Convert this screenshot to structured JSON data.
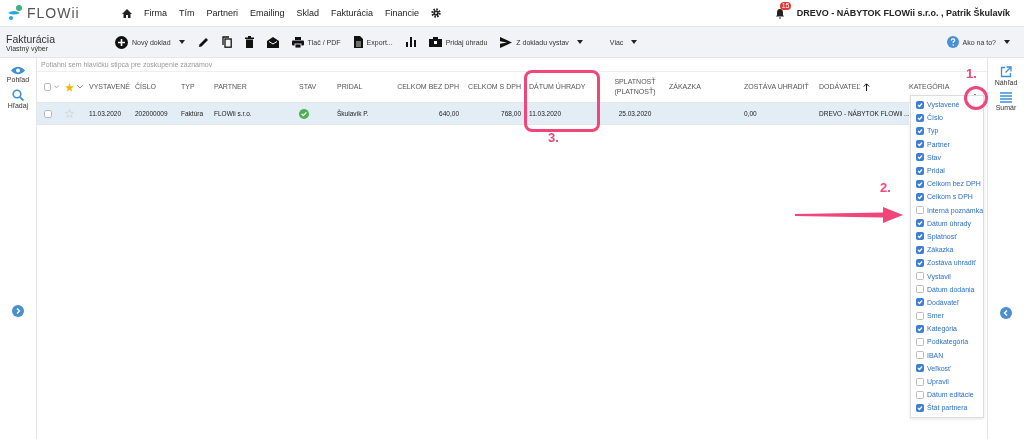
{
  "nav": {
    "logo": "FLOWii",
    "items": [
      "Firma",
      "Tím",
      "Partneri",
      "Emailing",
      "Sklad",
      "Fakturácia",
      "Financie"
    ],
    "notification_count": "15",
    "account": "DREVO - NÁBYTOK FLOWii s.r.o. , Patrik Škulavík"
  },
  "page": {
    "title": "Fakturácia",
    "subtitle": "Vlastný výber"
  },
  "toolbar": [
    {
      "kind": "new",
      "label": "Nový doklad",
      "dropdown": true
    },
    {
      "kind": "edit",
      "dropdown": false
    },
    {
      "kind": "copy",
      "dropdown": false
    },
    {
      "kind": "delete",
      "dropdown": false
    },
    {
      "kind": "mail",
      "dropdown": false
    },
    {
      "kind": "print",
      "label": "Tlač / PDF",
      "dropdown": false
    },
    {
      "kind": "export",
      "label": "Export...",
      "dropdown": false
    },
    {
      "kind": "chart",
      "dropdown": false
    },
    {
      "kind": "payment",
      "label": "Pridaj úhradu",
      "dropdown": false
    },
    {
      "kind": "send",
      "label": "Z dokladu vystav",
      "dropdown": true
    },
    {
      "kind": "more",
      "label": "Viac",
      "dropdown": true
    }
  ],
  "help": {
    "label": "Ako na to?"
  },
  "left_sidebar": [
    {
      "kind": "view",
      "label": "Pohľad"
    },
    {
      "kind": "search",
      "label": "Hľadaj"
    }
  ],
  "right_sidebar": [
    {
      "kind": "preview",
      "label": "Náhľad"
    },
    {
      "kind": "summary",
      "label": "Sumár"
    }
  ],
  "group_hint": "Potiahni sem hlavičku stĺpca pre zoskupenie záznamov",
  "select_all_checked": false,
  "columns": [
    {
      "label": "VYSTAVENÉ",
      "sorted": false
    },
    {
      "label": "ČÍSLO",
      "sorted": false
    },
    {
      "label": "TYP",
      "sorted": false
    },
    {
      "label": "PARTNER",
      "sorted": false
    },
    {
      "label": "STAV",
      "sorted": false
    },
    {
      "label": "PRIDAL",
      "sorted": false
    },
    {
      "label": "CELKOM BEZ DPH",
      "sorted": false
    },
    {
      "label": "CELKOM S DPH",
      "sorted": false
    },
    {
      "label": "DÁTUM ÚHRADY",
      "sorted": false
    },
    {
      "label": "SPLATNOSŤ (PLATNOSŤ)",
      "sorted": false
    },
    {
      "label": "ZÁKAZKA",
      "sorted": false
    },
    {
      "label": "ZOSTÁVA UHRADIŤ",
      "sorted": false
    },
    {
      "label": "DODÁVATEĽ",
      "sorted": true
    },
    {
      "label": "KATEGÓRIA",
      "sorted": false
    }
  ],
  "rows": [
    {
      "selected": true,
      "checked": false,
      "starred": false,
      "cells": [
        {
          "text": "11.03.2020"
        },
        {
          "text": "202000009"
        },
        {
          "text": "Faktúra"
        },
        {
          "text": "FLOWii s.r.o."
        },
        {
          "kind": "ok"
        },
        {
          "text": "Škulavík P."
        },
        {
          "text": "640,00"
        },
        {
          "text": "768,00"
        },
        {
          "text": "11.03.2020"
        },
        {
          "text": "25.03.2020"
        },
        {},
        {
          "text": "0,00"
        },
        {
          "text": "DREVO - NÁBYTOK FLOWii ..."
        },
        {}
      ]
    }
  ],
  "column_chooser": [
    {
      "label": "Vystavené",
      "checked": true
    },
    {
      "label": "Číslo",
      "checked": true
    },
    {
      "label": "Typ",
      "checked": true
    },
    {
      "label": "Partner",
      "checked": true
    },
    {
      "label": "Stav",
      "checked": true
    },
    {
      "label": "Pridal",
      "checked": true
    },
    {
      "label": "Celkom bez DPH",
      "checked": true
    },
    {
      "label": "Celkom s DPH",
      "checked": true
    },
    {
      "label": "Interná poznámka",
      "checked": false
    },
    {
      "label": "Dátum úhrady",
      "checked": true
    },
    {
      "label": "Splatnosť",
      "checked": true
    },
    {
      "label": "Zákazka",
      "checked": true
    },
    {
      "label": "Zostáva uhradiť",
      "checked": true
    },
    {
      "label": "Vystavil",
      "checked": false
    },
    {
      "label": "Dátum dodania",
      "checked": false
    },
    {
      "label": "Dodávateľ",
      "checked": true
    },
    {
      "label": "Smer",
      "checked": false
    },
    {
      "label": "Kategória",
      "checked": true
    },
    {
      "label": "Podkategória",
      "checked": false
    },
    {
      "label": "IBAN",
      "checked": false
    },
    {
      "label": "Veľkosť",
      "checked": true
    },
    {
      "label": "Upravil",
      "checked": false
    },
    {
      "label": "Dátum editácie",
      "checked": false
    },
    {
      "label": "Štát partnera",
      "checked": true
    }
  ],
  "annotations": [
    "1.",
    "2.",
    "3."
  ]
}
